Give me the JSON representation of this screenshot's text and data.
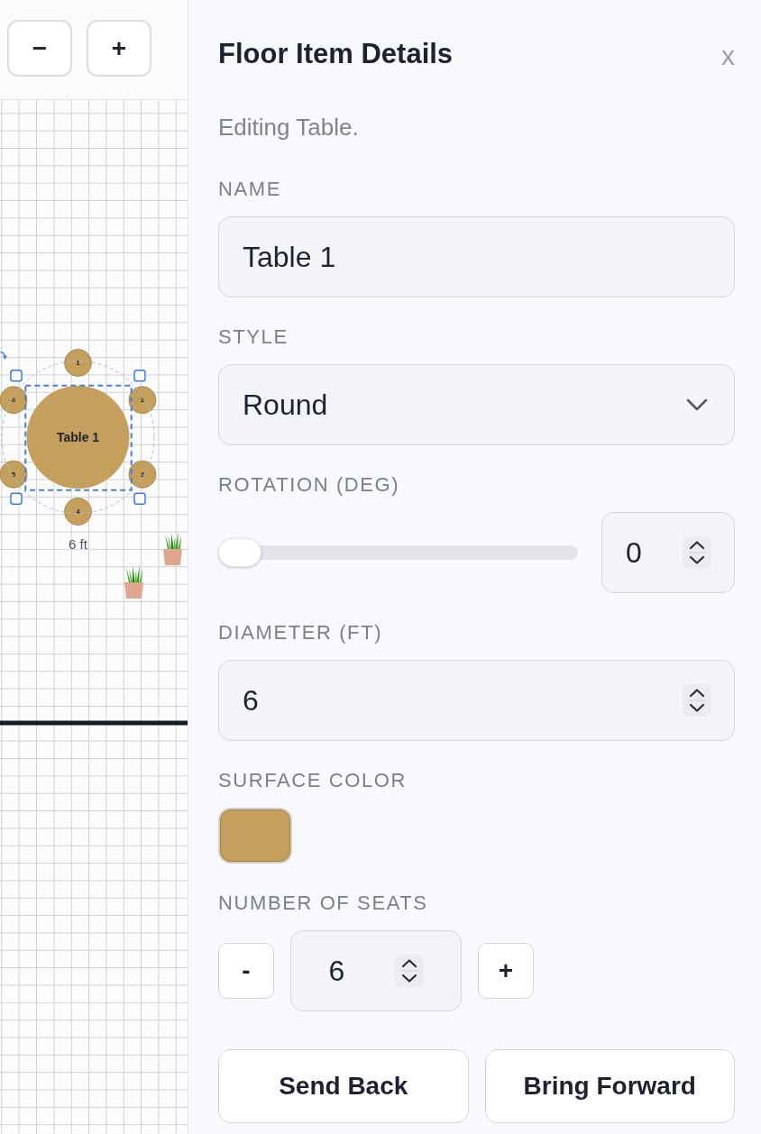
{
  "toolbar": {
    "zoom_out": "−",
    "zoom_in": "+"
  },
  "canvas": {
    "table": {
      "name": "Table 1",
      "selected": true,
      "seats": [
        "1",
        "2",
        "3",
        "4",
        "5",
        "6"
      ],
      "size_label": "6 ft"
    }
  },
  "panel": {
    "title": "Floor Item Details",
    "close": "x",
    "subtitle": "Editing Table.",
    "fields": [
      {
        "kind": "text",
        "label": "NAME",
        "value": "Table 1"
      },
      {
        "kind": "select",
        "label": "STYLE",
        "value": "Round"
      },
      {
        "kind": "slider",
        "label": "ROTATION (DEG)",
        "level": 0,
        "value": "0"
      },
      {
        "kind": "number",
        "label": "DIAMETER (FT)",
        "value": "6"
      },
      {
        "kind": "color",
        "label": "SURFACE COLOR",
        "color": "#c59f5c"
      },
      {
        "kind": "stepper",
        "label": "NUMBER OF SEATS",
        "value": "6",
        "decrement": "-",
        "increment": "+"
      }
    ],
    "actions": [
      "Send Back",
      "Bring Forward"
    ]
  }
}
